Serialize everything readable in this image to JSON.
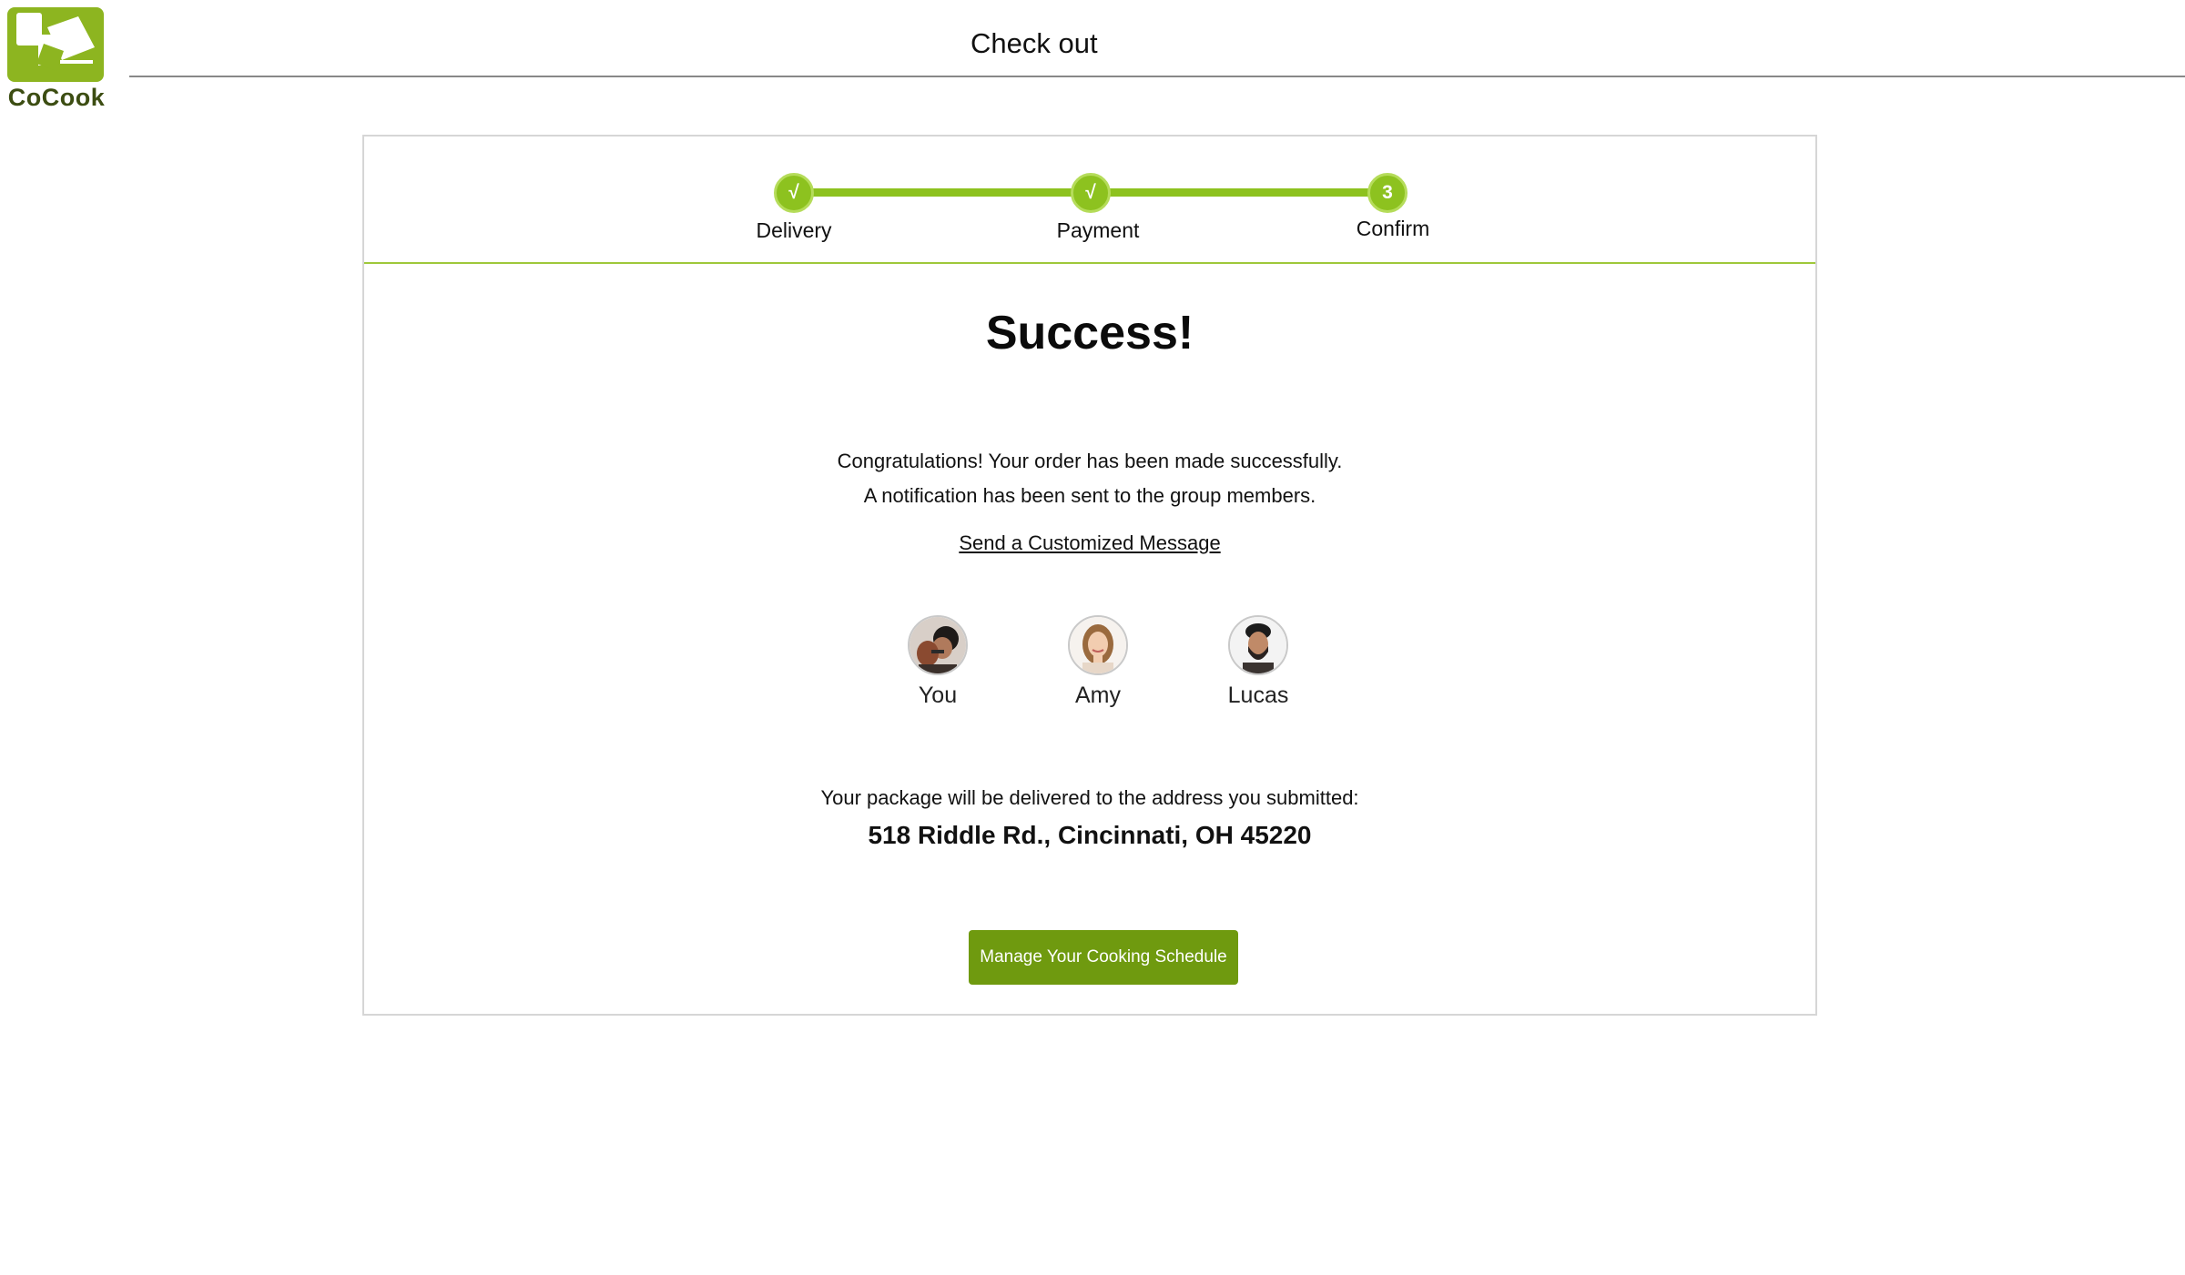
{
  "app": {
    "logo_text": "CoCook",
    "header_title": "Check out"
  },
  "steps": [
    {
      "label": "Delivery",
      "marker": "√",
      "state": "done"
    },
    {
      "label": "Payment",
      "marker": "√",
      "state": "done"
    },
    {
      "label": "Confirm",
      "marker": "3",
      "state": "current"
    }
  ],
  "success": {
    "title": "Success!",
    "line1": "Congratulations! Your order has been made successfully.",
    "line2": "A notification has been sent to the group members.",
    "link_label": "Send a Customized Message"
  },
  "members": [
    {
      "name": "You",
      "avatar_icon": "avatar-you"
    },
    {
      "name": "Amy",
      "avatar_icon": "avatar-amy"
    },
    {
      "name": "Lucas",
      "avatar_icon": "avatar-lucas"
    }
  ],
  "delivery": {
    "note": "Your package will be delivered to the address you submitted:",
    "address": "518 Riddle Rd., Cincinnati, OH 45220"
  },
  "cta": {
    "label": "Manage Your Cooking Schedule"
  },
  "colors": {
    "brand_green": "#8dc21f",
    "button_green": "#6f9a0f",
    "logo_green": "#8db520"
  }
}
